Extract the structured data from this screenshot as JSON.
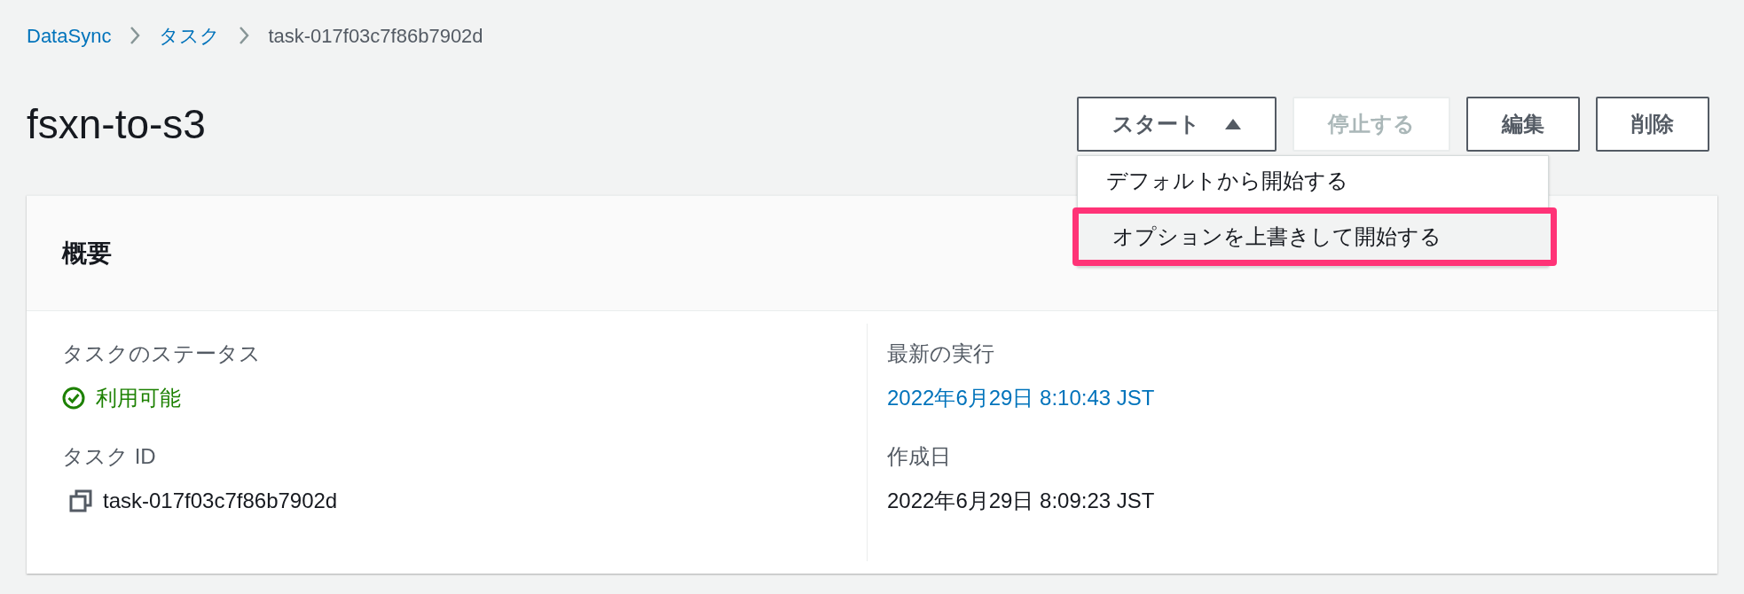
{
  "breadcrumbs": [
    {
      "label": "DataSync",
      "link": true
    },
    {
      "label": "タスク",
      "link": true
    },
    {
      "label": "task-017f03c7f86b7902d",
      "link": false
    }
  ],
  "title": "fsxn-to-s3",
  "actions": [
    {
      "label": "スタート",
      "kind": "dropdown",
      "disabled": false,
      "expanded": true
    },
    {
      "label": "停止する",
      "kind": "button",
      "disabled": true
    },
    {
      "label": "編集",
      "kind": "button",
      "disabled": false
    },
    {
      "label": "削除",
      "kind": "button",
      "disabled": false
    }
  ],
  "start_menu": [
    {
      "label": "デフォルトから開始する",
      "highlighted": false
    },
    {
      "label": "オプションを上書きして開始する",
      "highlighted": true
    }
  ],
  "summary": {
    "heading": "概要",
    "left": [
      {
        "label": "タスクのステータス",
        "value": "利用可能",
        "kind": "status"
      },
      {
        "label": "タスク ID",
        "value": "task-017f03c7f86b7902d",
        "kind": "copy"
      }
    ],
    "right": [
      {
        "label": "最新の実行",
        "value": "2022年6月29日 8:10:43 JST",
        "kind": "link"
      },
      {
        "label": "作成日",
        "value": "2022年6月29日 8:09:23 JST",
        "kind": "text"
      }
    ]
  }
}
